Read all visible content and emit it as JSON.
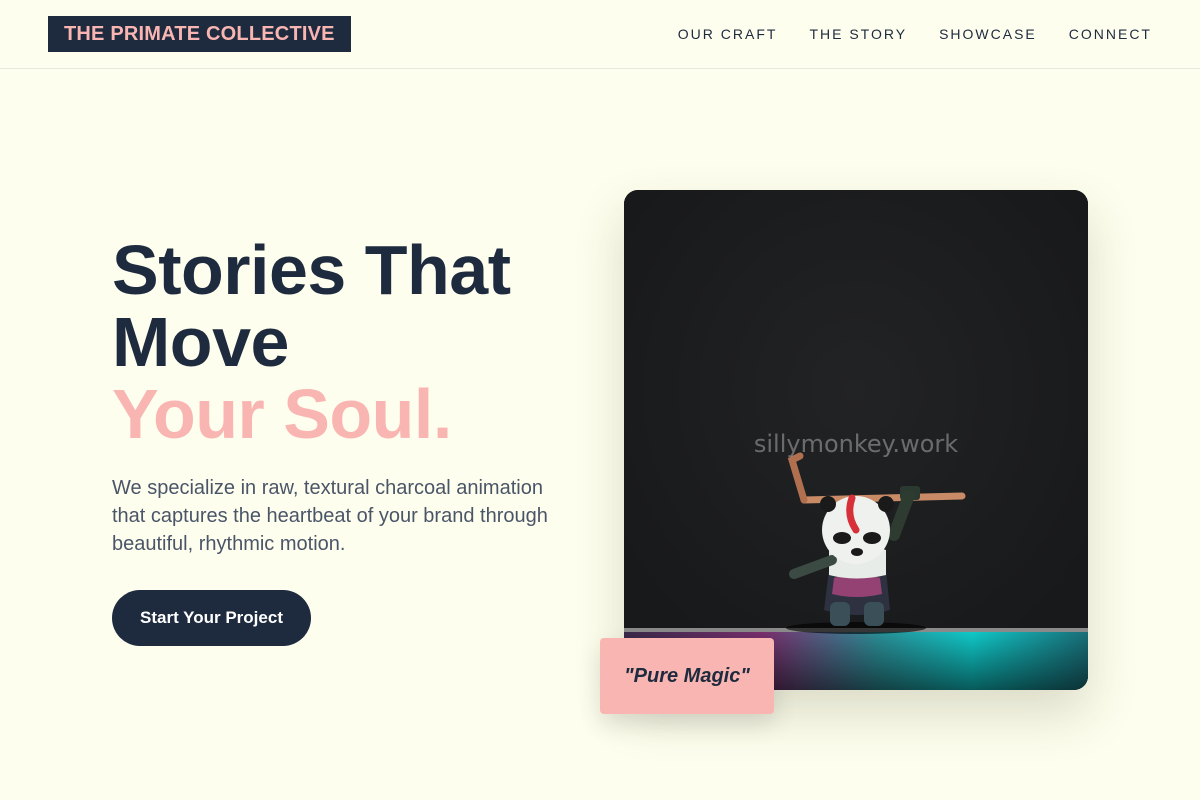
{
  "header": {
    "logo": "THE PRIMATE COLLECTIVE",
    "nav": [
      "OUR CRAFT",
      "THE STORY",
      "SHOWCASE",
      "CONNECT"
    ]
  },
  "hero": {
    "headline_line1": "Stories That",
    "headline_line2": "Move",
    "headline_accent": "Your Soul.",
    "description": "We specialize in raw, textural charcoal animation that captures the heartbeat of your brand through beautiful, rhythmic motion.",
    "cta_label": "Start Your Project"
  },
  "media": {
    "watermark": "sillymonkey.work",
    "quote": "\"Pure Magic\""
  },
  "colors": {
    "navy": "#1e2a3e",
    "pink": "#f9b5b2",
    "background": "#fefeee"
  }
}
